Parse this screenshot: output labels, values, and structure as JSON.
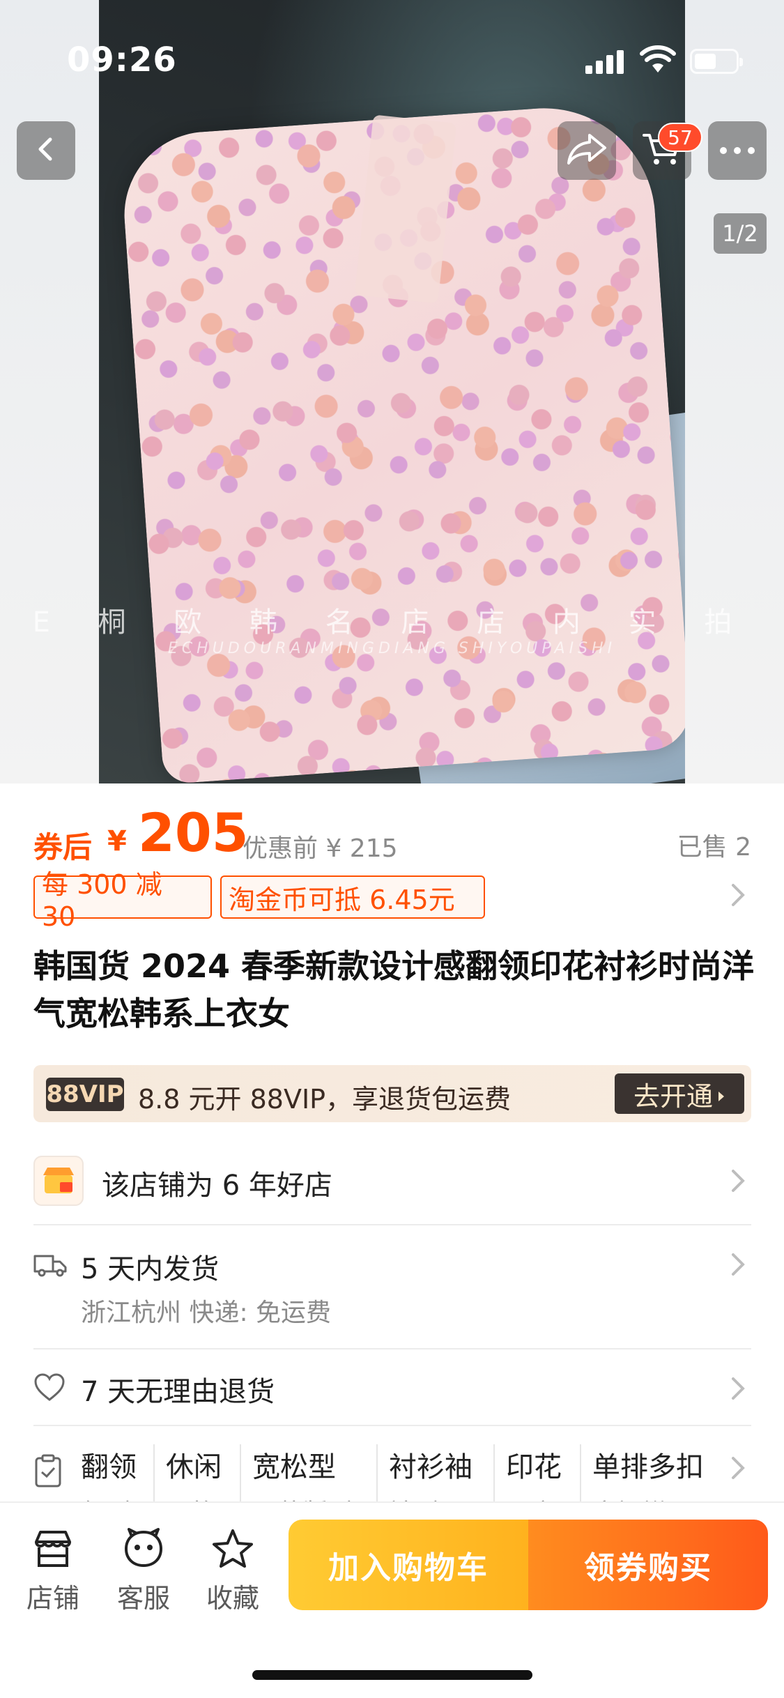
{
  "status_bar": {
    "time": "09:26"
  },
  "hero": {
    "watermark": "E 桐 欧 韩 名 店 店 内 实 拍",
    "watermark_sub": "ECHUDOURANMINGDIANG  SHIYOUPAISHI",
    "cart_count": "57",
    "page_indicator": "1/2"
  },
  "price": {
    "coupon_label": "券后",
    "currency": "¥",
    "value": "205",
    "original": "优惠前 ¥ 215",
    "sold": "已售 2"
  },
  "tags": [
    "每 300 减 30",
    "淘金币可抵 6.45元"
  ],
  "title": "韩国货 2024 春季新款设计感翻领印花衬衫时尚洋气宽松韩系上衣女",
  "vip": {
    "logo": "88VIP",
    "text": "8.8 元开 88VIP，享退货包运费",
    "button": "去开通"
  },
  "shop": {
    "text": "该店铺为 6 年好店"
  },
  "shipping": {
    "title": "5 天内发货",
    "detail": "浙江杭州  快递: 免运费"
  },
  "returns": {
    "text": "7 天无理由退货"
  },
  "attributes": [
    {
      "value": "翻领",
      "label": "领型"
    },
    {
      "value": "休闲",
      "label": "风格"
    },
    {
      "value": "宽松型",
      "label": "服装版型"
    },
    {
      "value": "衬衫袖",
      "label": "袖型"
    },
    {
      "value": "印花",
      "label": "图案"
    },
    {
      "value": "单排多扣",
      "label": "衣门襟"
    }
  ],
  "bottom_bar": {
    "store": "店铺",
    "service": "客服",
    "favorite": "收藏",
    "add_to_cart": "加入购物车",
    "buy": "领券购买"
  },
  "colors": {
    "accent": "#ff5000",
    "cart_btn": "#ffb21e",
    "buy_btn": "#ff5a1a"
  },
  "icons": [
    "back-icon",
    "share-icon",
    "cart-icon",
    "more-icon",
    "shop-badge-icon",
    "truck-icon",
    "heart-shield-icon",
    "clipboard-icon",
    "store-icon",
    "smiley-icon",
    "star-icon"
  ]
}
